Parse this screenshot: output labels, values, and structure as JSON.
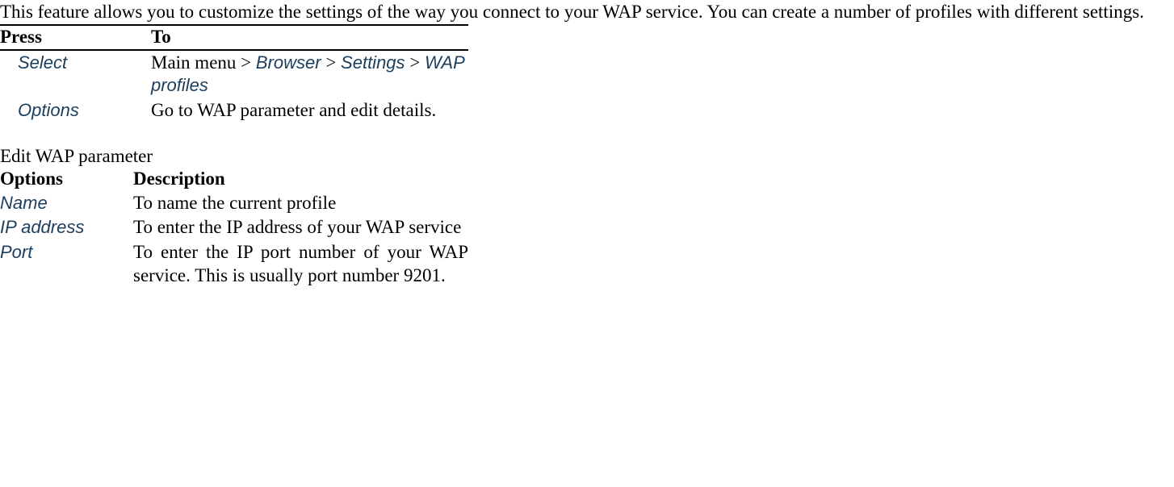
{
  "intro": "This feature allows you to customize the settings of the way you connect to your WAP service. You can create a number of profiles with different settings.",
  "table1": {
    "headers": {
      "press": "Press",
      "to": "To"
    },
    "rows": [
      {
        "press": "Select",
        "to_pre": "Main menu > ",
        "nav1": "Browser",
        "sep1": " > ",
        "nav2": "Settings",
        "sep2": " > ",
        "nav3": "WAP profiles"
      },
      {
        "press": "Options",
        "to": "Go to WAP parameter and edit details."
      }
    ]
  },
  "section2_title": "Edit WAP parameter",
  "table2": {
    "headers": {
      "options": "Options",
      "description": "Description"
    },
    "rows": [
      {
        "opt": "Name",
        "desc": "To name the current profile"
      },
      {
        "opt": "IP address",
        "desc": "To enter the IP address of your WAP service"
      },
      {
        "opt": "Port",
        "desc": "To enter the IP port number of your WAP service. This is usually port number 9201."
      }
    ]
  }
}
